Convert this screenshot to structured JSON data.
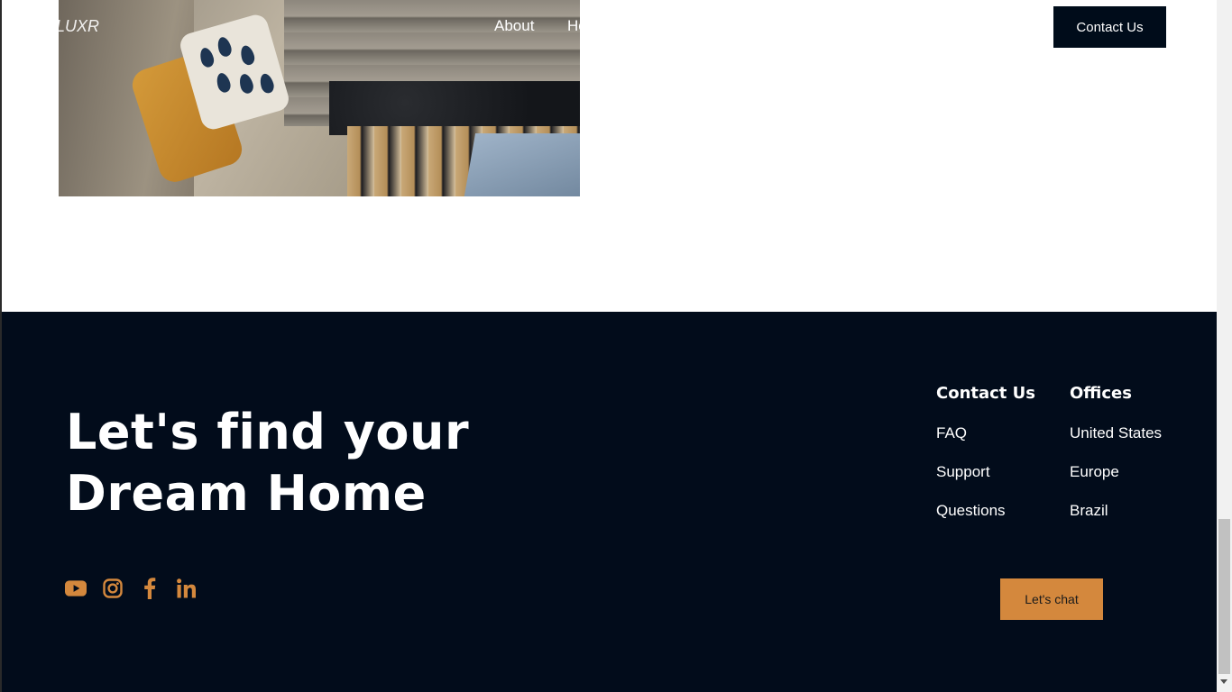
{
  "nav": {
    "logo": "LUXR",
    "about": "About",
    "next_item": "Home",
    "contact_button": "Contact Us"
  },
  "footer": {
    "heading_line1": "Let's find your",
    "heading_line2": "Dream Home",
    "social": [
      "youtube-icon",
      "instagram-icon",
      "facebook-icon",
      "linkedin-icon"
    ],
    "contact_column": {
      "title": "Contact Us",
      "links": [
        "FAQ",
        "Support",
        "Questions"
      ]
    },
    "offices_column": {
      "title": "Offices",
      "links": [
        "United States",
        "Europe",
        "Brazil"
      ]
    },
    "chat_button": "Let's chat"
  },
  "colors": {
    "footer_bg": "#020c1b",
    "accent": "#d4883d",
    "button_dark": "#000c1a"
  }
}
